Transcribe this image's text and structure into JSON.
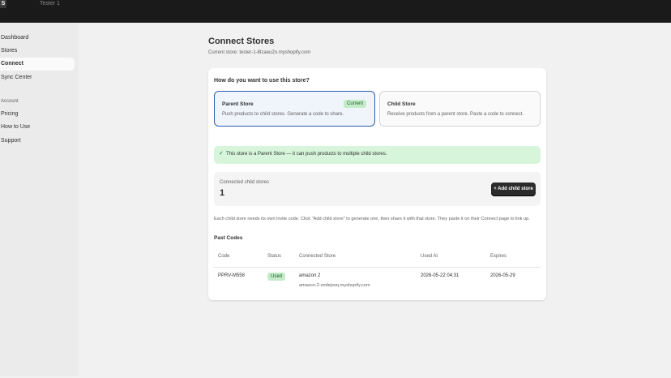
{
  "topbar": {
    "logo": "S",
    "shop_name": "Tester 1"
  },
  "sidebar": {
    "items": [
      {
        "label": "Dashboard"
      },
      {
        "label": "Stores"
      },
      {
        "label": "Connect"
      },
      {
        "label": "Sync Center"
      }
    ],
    "account_heading": "Account",
    "account_items": [
      {
        "label": "Pricing"
      },
      {
        "label": "How to Use"
      },
      {
        "label": "Support"
      }
    ]
  },
  "page": {
    "title": "Connect Stores",
    "subtitle": "Current store: tester-1-8lzaeu2n.myshopify.com"
  },
  "card": {
    "question": "How do you want to use this store?",
    "options": [
      {
        "title": "Parent Store",
        "desc": "Push products to child stores. Generate a code to share.",
        "badge": "Current"
      },
      {
        "title": "Child Store",
        "desc": "Receive products from a parent store. Paste a code to connect."
      }
    ],
    "banner": {
      "icon": "check-icon",
      "text": "This store is a Parent Store — it can push products to multiple child stores."
    },
    "connected": {
      "label": "Connected child stores",
      "count": "1",
      "add_button": "+ Add child store"
    },
    "help_text": "Each child store needs its own invite code. Click \"Add child store\" to generate one, then share it with that store. They paste it on their Connect page to link up.",
    "past_codes": {
      "title": "Past Codes",
      "headers": [
        "Code",
        "Status",
        "Connected Store",
        "Used At",
        "Expires"
      ],
      "rows": [
        {
          "code": "PPRV-M558",
          "status": "Used",
          "store_name": "amazon 2",
          "store_domain": "amazon-2-zndejxoq.myshopify.com",
          "used_at": "2026-05-22 04:31",
          "expires": "2026-05-29"
        }
      ]
    }
  },
  "colors": {
    "topbar": "#1a1a1a",
    "accent": "#2c5fad",
    "success_bg": "#d6f5da",
    "button": "#2b2b2b"
  }
}
